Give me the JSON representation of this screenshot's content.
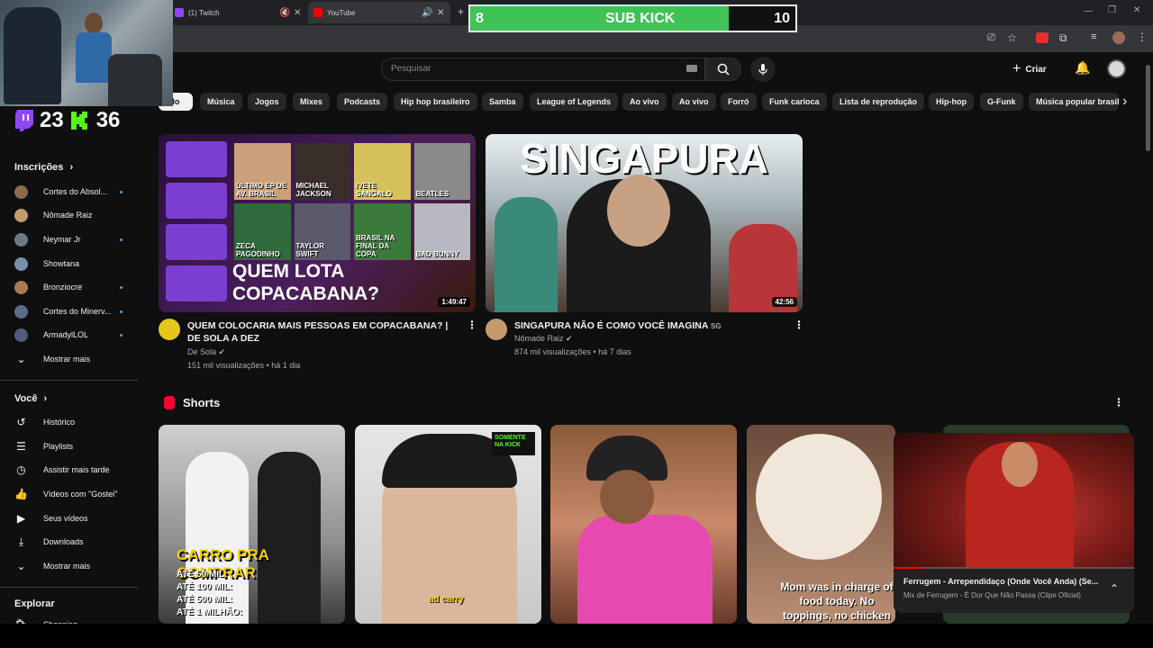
{
  "tabs": [
    {
      "title": "(1) Twitch",
      "color": "#9146ff"
    },
    {
      "title": "YouTube",
      "color": "#ff0000"
    }
  ],
  "subkick": {
    "left": "8",
    "label": "SUB KICK",
    "right": "10",
    "progress": 0.8
  },
  "stream_stats": {
    "twitch_count": "23",
    "kick_count": "36"
  },
  "sidebar": {
    "subscriptions_title": "Inscrições",
    "subscriptions": [
      {
        "name": "Cortes do Absol...",
        "color": "#8a6b4e",
        "new": true
      },
      {
        "name": "Nômade Raiz",
        "color": "#c49a6c",
        "new": false
      },
      {
        "name": "Neymar Jr",
        "color": "#6a7a88",
        "new": true
      },
      {
        "name": "Showtana",
        "color": "#7a8fa8",
        "new": false
      },
      {
        "name": "Bronziocre",
        "color": "#a67c52",
        "new": true
      },
      {
        "name": "Cortes do Minerv...",
        "color": "#5a6e8c",
        "new": true
      },
      {
        "name": "ArmadylLOL",
        "color": "#4e5f7a",
        "new": true
      }
    ],
    "show_more": "Mostrar mais",
    "you_title": "Você",
    "you_items": [
      {
        "label": "Histórico",
        "icon": "history-icon"
      },
      {
        "label": "Playlists",
        "icon": "playlists-icon"
      },
      {
        "label": "Assistir mais tarde",
        "icon": "watch-later-icon"
      },
      {
        "label": "Vídeos com \"Gostei\"",
        "icon": "like-icon"
      },
      {
        "label": "Seus vídeos",
        "icon": "your-videos-icon"
      },
      {
        "label": "Downloads",
        "icon": "downloads-icon"
      }
    ],
    "show_more_2": "Mostrar mais",
    "explore_title": "Explorar",
    "explore_partial": "Shopping"
  },
  "search": {
    "placeholder": "Pesquisar"
  },
  "header": {
    "create_label": "Criar"
  },
  "chips": [
    "Tudo",
    "Música",
    "Jogos",
    "Mixes",
    "Podcasts",
    "Hip hop brasileiro",
    "Samba",
    "League of Legends",
    "Ao vivo",
    "Ao vivo",
    "Forró",
    "Funk carioca",
    "Lista de reprodução",
    "Hip-hop",
    "G-Funk",
    "Música popular brasile"
  ],
  "videos": [
    {
      "title": "QUEM COLOCARIA MAIS PESSOAS EM COPACABANA? | DE SOLA A DEZ",
      "channel": "De Sola",
      "meta": "151 mil visualizações • há 1 dia",
      "duration": "1:49:47",
      "thumb_text": "QUEM LOTA COPACABANA?",
      "thumb_labels": [
        "ÚLTIMO EP DE AV. BRASIL",
        "MICHAEL JACKSON",
        "IVETE SANGALO",
        "BEATLES",
        "ZECA PAGODINHO",
        "TAYLOR SWIFT",
        "BRASIL NA FINAL DA COPA",
        "BAD BUNNY"
      ]
    },
    {
      "title": "SINGAPURA NÃO É COMO VOCÊ IMAGINA",
      "title_suffix": "SG",
      "channel": "Nômade Raiz",
      "meta": "874 mil visualizações • há 7 dias",
      "duration": "42:56",
      "thumb_text": "SINGAPURA"
    }
  ],
  "shorts": {
    "title": "Shorts",
    "items": [
      {
        "caption": "CARRO PRA COMPRAR",
        "lines": [
          "ATÉ 50 MIL:",
          "ATÉ 100 MIL:",
          "ATÉ 500 MIL:",
          "ATÉ 1 MILHÃO:"
        ]
      },
      {
        "caption": "ad carry",
        "badge": "SOMENTE NA KICK"
      },
      {
        "caption": ""
      },
      {
        "caption": "Mom was in charge of food today. No toppings, no chicken"
      }
    ]
  },
  "mini_player": {
    "title": "Ferrugem - Arrependidaço (Onde Você Anda) (Se...",
    "subtitle": "Mix de Ferrugem - É Dor Que Não Passa (Clipe Oficial)",
    "progress": 0.12
  }
}
